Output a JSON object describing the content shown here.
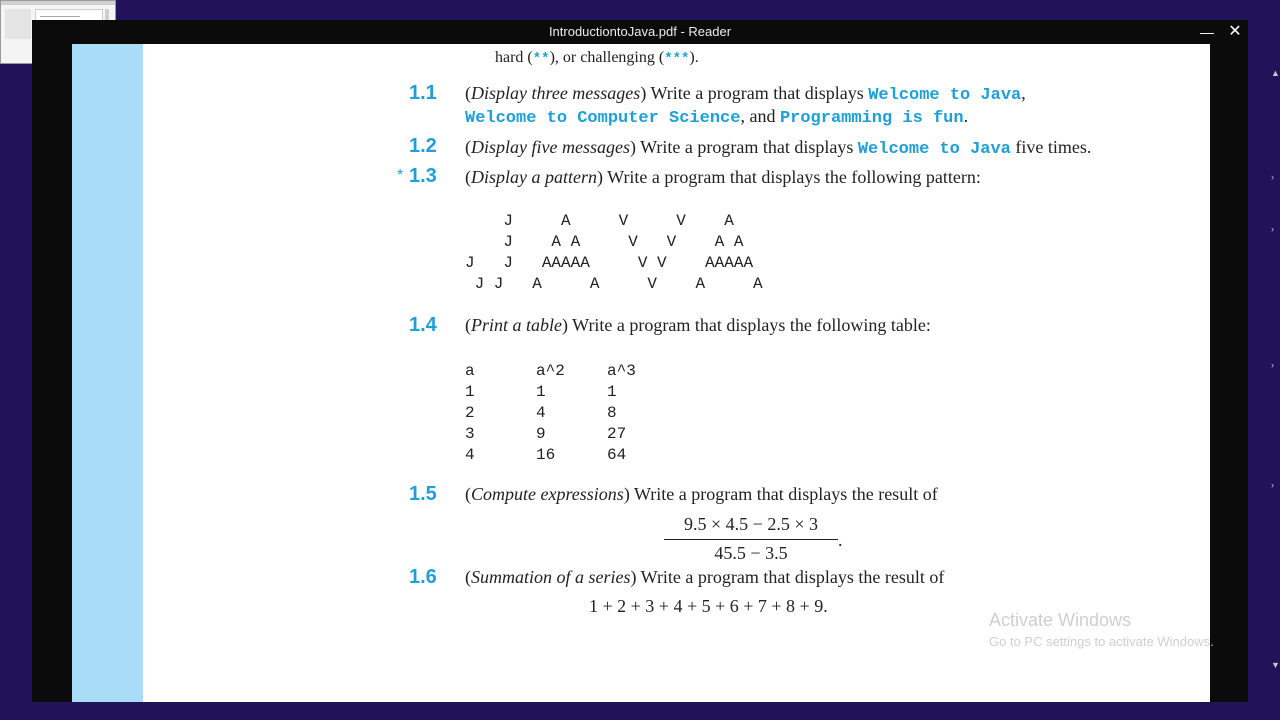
{
  "window": {
    "title": "IntroductiontoJava.pdf - Reader",
    "minimize_glyph": "—",
    "close_glyph": "✕"
  },
  "colors": {
    "accent": "#1e9fd9",
    "sidebar": "#a9dcf6",
    "desktop": "#22125a"
  },
  "intro": {
    "p1": "hard (",
    "stars2": "**",
    "p2": "), or challenging (",
    "stars3": "***",
    "p3": ")."
  },
  "exercises": {
    "e1": {
      "number": "1.1",
      "title": "Display three messages",
      "text": ") Write a program that displays ",
      "code1": "Welcome to Java",
      "sep1": ",",
      "code2": "Welcome to Computer Science",
      "sep2": ", and ",
      "code3": "Programming is fun",
      "end": "."
    },
    "e2": {
      "number": "1.2",
      "title": "Display five messages",
      "text": ") Write a program that displays ",
      "code": "Welcome to Java",
      "end": " five times."
    },
    "e3": {
      "star": "*",
      "number": "1.3",
      "title": "Display a pattern",
      "text": ") Write a program that displays the following pattern:",
      "pattern": [
        "    J     A     V     V    A",
        "    J    A A     V   V    A A",
        "J   J   AAAAA     V V    AAAAA",
        " J J   A     A     V    A     A"
      ]
    },
    "e4": {
      "number": "1.4",
      "title": "Print a table",
      "text": ") Write a program that displays the following table:",
      "table": [
        [
          "a",
          "a^2",
          "a^3"
        ],
        [
          "1",
          "1",
          "1"
        ],
        [
          "2",
          "4",
          "8"
        ],
        [
          "3",
          "9",
          "27"
        ],
        [
          "4",
          "16",
          "64"
        ]
      ]
    },
    "e5": {
      "number": "1.5",
      "title": "Compute expressions",
      "text": ") Write a program that displays the result of",
      "numerator": "9.5 × 4.5 − 2.5 × 3",
      "denominator": "45.5 − 3.5",
      "end": "."
    },
    "e6": {
      "number": "1.6",
      "title": "Summation of a series",
      "text": ") Write a program that displays the result of",
      "series": "1 + 2 + 3 + 4 + 5 + 6 + 7 + 8 + 9."
    }
  },
  "activation": {
    "title": "Activate Windows",
    "subtitle": "Go to PC settings to activate Windows."
  }
}
